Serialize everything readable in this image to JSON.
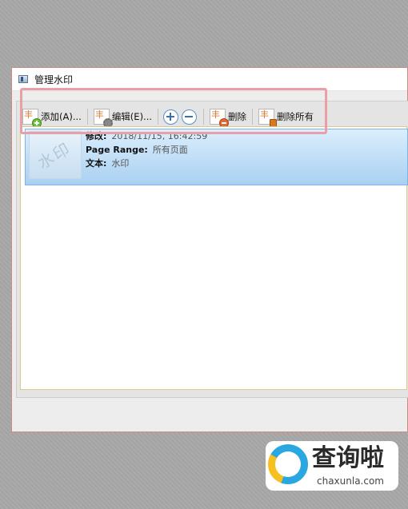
{
  "window": {
    "title": "管理水印"
  },
  "toolbar": {
    "add_label": "添加(A)...",
    "edit_label": "编辑(E)...",
    "delete_label": "删除",
    "delete_all_label": "删除所有"
  },
  "watermark_item": {
    "thumbnail_text": "水印",
    "modified_label": "修改:",
    "modified_value": "2018/11/15, 16:42:59",
    "page_range_label": "Page Range:",
    "page_range_value": "所有页面",
    "text_label": "文本:",
    "text_value": "水印"
  },
  "brand": {
    "name_cn": "查询啦",
    "url": "chaxunla.com"
  },
  "colors": {
    "selection": "#a9d0f2",
    "highlight": "#e8a0a6",
    "accent": "#2aa6e0"
  }
}
